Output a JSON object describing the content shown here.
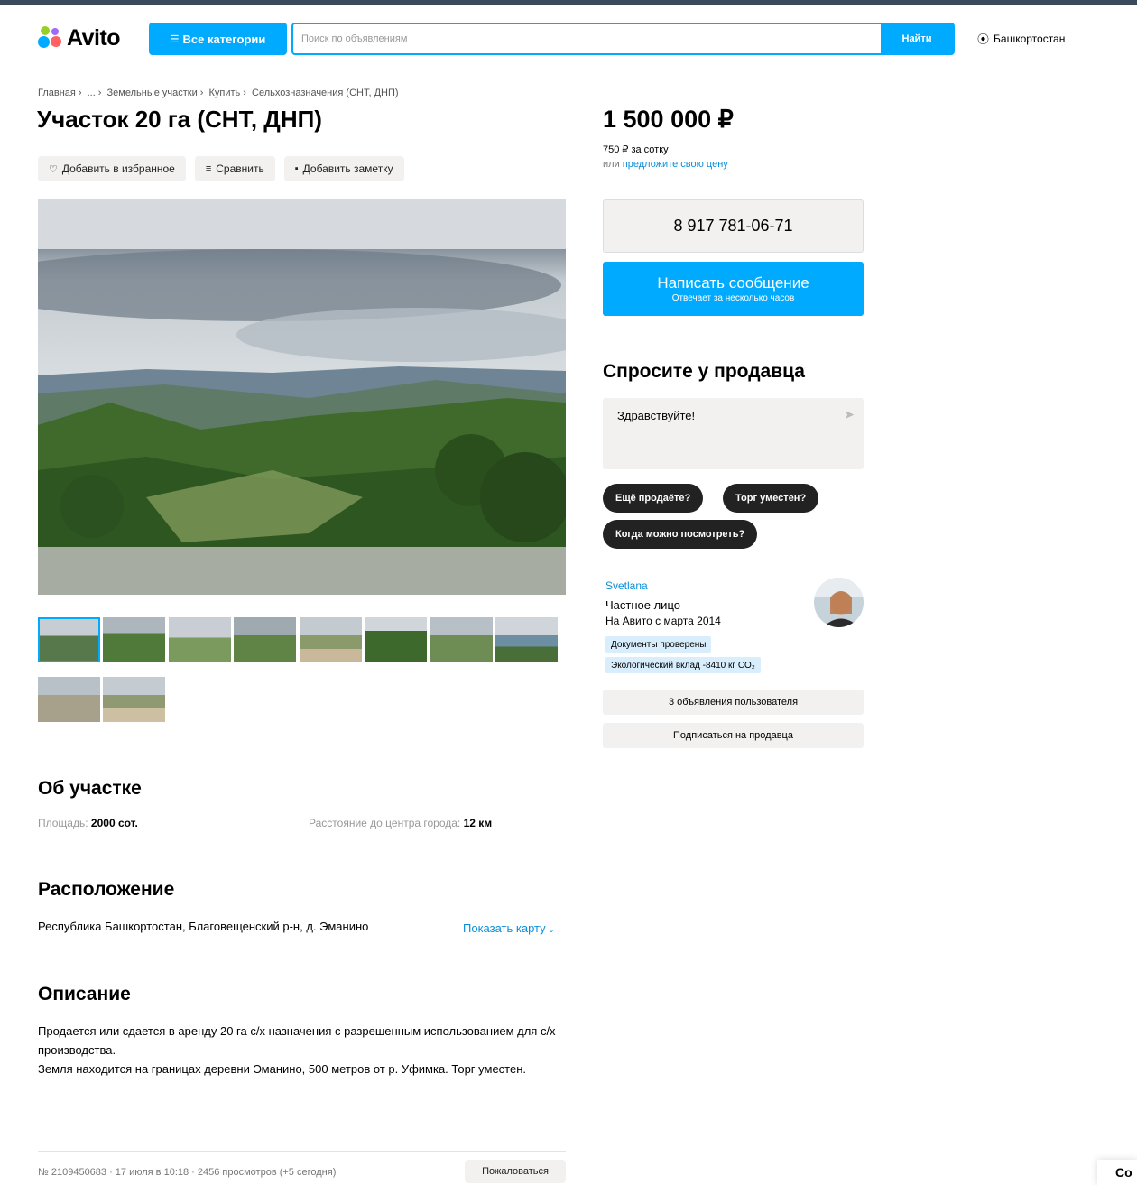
{
  "header": {
    "logo_text": "Avito",
    "categories_label": "Все категории",
    "search": {
      "placeholder": "Поиск по объявлениям",
      "button_label": "Найти"
    },
    "region": "Башкортостан"
  },
  "breadcrumbs": [
    "Главная",
    "...",
    "Земельные участки",
    "Купить",
    "Сельхозназначения (СНТ, ДНП)"
  ],
  "listing": {
    "title": "Участок 20 га (СНТ, ДНП)",
    "actions": {
      "favorite": "Добавить в избранное",
      "compare": "Сравнить",
      "note": "Добавить заметку"
    },
    "gallery": {
      "thumbnail_count": 10,
      "selected_index": 0
    }
  },
  "about": {
    "heading": "Об участке",
    "area_label": "Площадь:",
    "area_value": "2000 сот.",
    "distance_label": "Расстояние до центра города:",
    "distance_value": "12 км"
  },
  "location": {
    "heading": "Расположение",
    "address": "Республика Башкортостан, Благовещенский р-н, д. Эманино",
    "map_link": "Показать карту"
  },
  "description": {
    "heading": "Описание",
    "lines": [
      "Продается или сдается в аренду 20 га с/х назначения с разрешенным использованием для с/х производства.",
      "Земля находится на границах деревни Эманино, 500 метров от р. Уфимка. Торг уместен."
    ]
  },
  "footer": {
    "meta": "№ 2109450683 · 17 июля в 10:18 · 2456 просмотров (+5 сегодня)",
    "report": "Пожаловаться",
    "corner_text": "Co"
  },
  "sidebar": {
    "price": "1 500 000 ₽",
    "per_sotka": "750 ₽ за сотку",
    "offer_prefix": "или",
    "offer_link": "предложите свою цену",
    "phone": "8 917 781-06-71",
    "message_button": "Написать сообщение",
    "message_sub": "Отвечает за несколько часов",
    "ask_heading": "Спросите у продавца",
    "ask_text": "Здравствуйте!",
    "quick_replies": [
      "Ещё продаёте?",
      "Торг уместен?",
      "Когда можно посмотреть?"
    ],
    "seller": {
      "name": "Svetlana",
      "type": "Частное лицо",
      "since": "На Авито с марта 2014",
      "badges": [
        "Документы проверены",
        "Экологический вклад -8410 кг CO₂"
      ]
    },
    "seller_ads": "3 объявления пользователя",
    "subscribe": "Подписаться на продавца"
  },
  "colors": {
    "accent": "#00aaff",
    "link": "#0a8fd8",
    "chip": "#222222",
    "button_bg": "#f2f1f0"
  }
}
